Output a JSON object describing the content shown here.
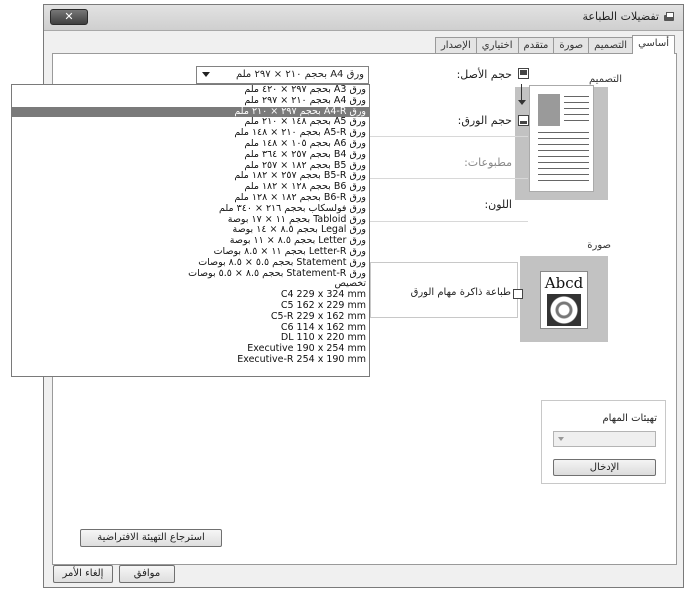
{
  "window": {
    "title": "تفضيلات الطباعة",
    "close_label": "✕"
  },
  "tabs": [
    "أساسي",
    "التصميم",
    "صورة",
    "متقدم",
    "اختياري",
    "الإصدار"
  ],
  "active_tab": "أساسي",
  "sections": {
    "design_label": "التصميم",
    "image_label": "صورة",
    "image_sample_text": "Abcd"
  },
  "form": {
    "original_size_label": "حجم الأصل:",
    "paper_size_label": "حجم الورق:",
    "prints_label": "مطبوعات:",
    "color_label": "اللون:",
    "original_size_value": "ورق A4 بحجم ٢١٠ × ٢٩٧ ملم"
  },
  "paper_sizes": [
    "ورق A3 بحجم ٢٩٧ × ٤٢٠ ملم",
    "ورق A4 بحجم ٢١٠ × ٢٩٧ ملم",
    "ورق A4-R بحجم ٢٩٧ × ٢١٠ ملم",
    "ورق A5 بحجم ١٤٨ × ٢١٠ ملم",
    "ورق A5-R بحجم ٢١٠ × ١٤٨ ملم",
    "ورق A6 بحجم ١٠٥ × ١٤٨ ملم",
    "ورق B4 بحجم ٢٥٧ × ٣٦٤ ملم",
    "ورق B5 بحجم ١٨٢ × ٢٥٧ ملم",
    "ورق B5-R بحجم ٢٥٧ × ١٨٢ ملم",
    "ورق B6 بحجم ١٢٨ × ١٨٢ ملم",
    "ورق B6-R بحجم ١٨٢ × ١٢٨ ملم",
    "ورق فولسكاب بحجم ٢١٦ × ٣٤٠ ملم",
    "ورق Tabloid بحجم ١١ × ١٧ بوصة",
    "ورق Legal بحجم ٨.٥ × ١٤ بوصة",
    "ورق Letter بحجم ٨.٥ × ١١ بوصة",
    "ورق Letter-R بحجم ١١ × ٨.٥ بوصات",
    "ورق Statement بحجم ٥.٥ × ٨.٥ بوصات",
    "ورق Statement-R بحجم ٨.٥ × ٥.٥ بوصات",
    "تخصيص",
    "C4 229 x 324 mm",
    "C5 162 x 229 mm",
    "C5-R 229 x 162 mm",
    "C6 114 x 162 mm",
    "DL 110 x 220 mm",
    "Executive 190 x 254 mm",
    "Executive-R 254 x 190 mm"
  ],
  "selected_paper_index": 2,
  "job_storage_checkbox_label": "طباعة ذاكرة مهام الورق",
  "tasks": {
    "label": "تهيئات المهام",
    "enter_button": "الإدخال"
  },
  "buttons": {
    "restore_defaults": "استرجاع التهيئة الافتراضية",
    "ok": "موافق",
    "cancel": "إلغاء الأمر"
  }
}
